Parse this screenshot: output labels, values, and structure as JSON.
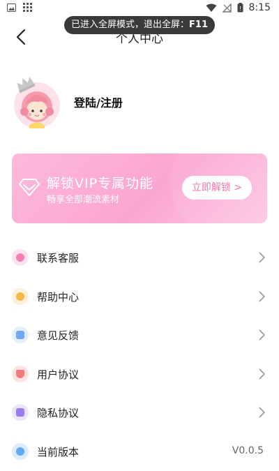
{
  "status_bar": {
    "time": "8:15"
  },
  "toast": {
    "text": "已进入全屏模式，退出全屏：",
    "key": "F11"
  },
  "header": {
    "title": "个人中心"
  },
  "profile": {
    "login_label": "登陆/注册"
  },
  "vip_banner": {
    "title": "解锁VIP专属功能",
    "subtitle": "畅享全部潮流素材",
    "button": "立即解锁 >"
  },
  "menu": {
    "items": [
      {
        "label": "联系客服",
        "icon": "customer-service-icon",
        "color": "#f77fb4"
      },
      {
        "label": "帮助中心",
        "icon": "help-icon",
        "color": "#f6b64a"
      },
      {
        "label": "意见反馈",
        "icon": "feedback-icon",
        "color": "#6fa8f0"
      },
      {
        "label": "用户协议",
        "icon": "user-agreement-icon",
        "color": "#f27a7a"
      },
      {
        "label": "隐私协议",
        "icon": "privacy-icon",
        "color": "#9a7cf0"
      },
      {
        "label": "当前版本",
        "icon": "info-icon",
        "color": "#5fa9f4"
      }
    ],
    "version": "V0.0.5"
  }
}
